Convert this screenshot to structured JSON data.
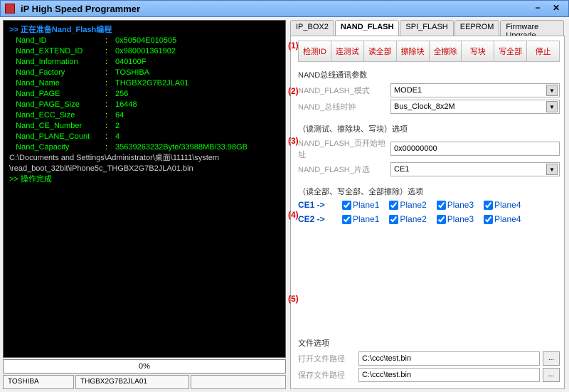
{
  "window": {
    "title": "iP High Speed Programmer"
  },
  "console": {
    "header": "正在准备Nand_Flash编程",
    "lines": [
      {
        "k": "Nand_ID",
        "v": "0x50504E010505"
      },
      {
        "k": "Nand_EXTEND_ID",
        "v": "0x980001361902"
      },
      {
        "k": "Nand_Information",
        "v": "040100F"
      },
      {
        "k": "Nand_Factory",
        "v": "TOSHIBA"
      },
      {
        "k": "Nand_Name",
        "v": "THGBX2G7B2JLA01"
      },
      {
        "k": "Nand_PAGE",
        "v": "256"
      },
      {
        "k": "Nand_PAGE_Size",
        "v": "16448"
      },
      {
        "k": "Nand_ECC_Size",
        "v": "64"
      },
      {
        "k": "Nand_CE_Number",
        "v": "2"
      },
      {
        "k": "Nand_PLANE_Count",
        "v": "4"
      },
      {
        "k": "Nand_Capacity",
        "v": "35639263232Byte/33988MB/33.98GB"
      }
    ],
    "path1": "C:\\Documents and Settings\\Administrator\\桌面\\11111\\system",
    "path2": "\\read_boot_32bit\\iPhone5c_THGBX2G7B2JLA01.bin",
    "footer": "操作完成"
  },
  "progress": {
    "text": "0%"
  },
  "status": {
    "c1": "TOSHIBA",
    "c2": "THGBX2G7B2JLA01"
  },
  "tabs": {
    "items": [
      "IP_BOX2",
      "NAND_FLASH",
      "SPI_FLASH",
      "EEPROM",
      "Firmware Upgrade"
    ],
    "active": 1
  },
  "toolbar": {
    "buttons": [
      "检测ID",
      "连测试",
      "读全部",
      "擦除块",
      "全擦除",
      "写块",
      "写全部",
      "停止"
    ]
  },
  "markers": {
    "m1": "(1)",
    "m2": "(2)",
    "m3": "(3)",
    "m4": "(4)",
    "m5": "(5)"
  },
  "group1": {
    "title": "NAND总线通讯参数",
    "mode_label": "NAND_FLASH_模式",
    "mode_value": "MODE1",
    "clock_label": "NAND_总线时钟",
    "clock_value": "Bus_Clock_8x2M"
  },
  "group2": {
    "title": "（读测试、擦除块、写块）选项",
    "addr_label": "NAND_FLASH_页开始地址",
    "addr_value": "0x00000000",
    "ce_label": "NAND_FLASH_片选",
    "ce_value": "CE1"
  },
  "group3": {
    "title": "（读全部、写全部、全部擦除）选项",
    "rows": [
      {
        "ce": "CE1 ->",
        "planes": [
          "Plane1",
          "Plane2",
          "Plane3",
          "Plane4"
        ]
      },
      {
        "ce": "CE2 ->",
        "planes": [
          "Plane1",
          "Plane2",
          "Plane3",
          "Plane4"
        ]
      }
    ]
  },
  "group4": {
    "title": "文件选项",
    "open_label": "打开文件路径",
    "open_value": "C:\\ccc\\test.bin",
    "save_label": "保存文件路径",
    "save_value": "C:\\ccc\\test.bin",
    "browse": "..."
  }
}
